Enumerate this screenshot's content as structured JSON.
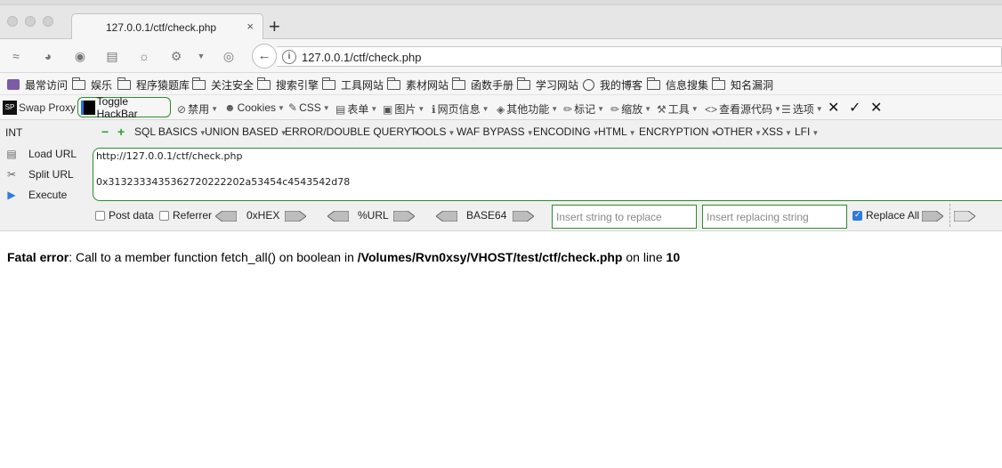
{
  "tab": {
    "title": "127.0.0.1/ctf/check.php",
    "close": "×",
    "new_tab": "+"
  },
  "nav": {
    "url": "127.0.0.1/ctf/check.php",
    "info_glyph": "i"
  },
  "bookmarks": [
    {
      "label": "最常访问",
      "icon": "purple-square-icon"
    },
    {
      "label": "娱乐",
      "icon": "folder-icon"
    },
    {
      "label": "程序猿题库",
      "icon": "folder-icon"
    },
    {
      "label": "关注安全",
      "icon": "folder-icon"
    },
    {
      "label": "搜索引擎",
      "icon": "folder-icon"
    },
    {
      "label": "工具网站",
      "icon": "folder-icon"
    },
    {
      "label": "素材网站",
      "icon": "folder-icon"
    },
    {
      "label": "函数手册",
      "icon": "folder-icon"
    },
    {
      "label": "学习网站",
      "icon": "folder-icon"
    },
    {
      "label": "我的博客",
      "icon": "globe-icon"
    },
    {
      "label": "信息搜集",
      "icon": "folder-icon"
    },
    {
      "label": "知名漏洞",
      "icon": "folder-icon"
    }
  ],
  "extensions": {
    "swap_proxy": "Swap Proxy",
    "sp_glyph": "SP",
    "toggle_hackbar": "Toggle HackBar",
    "items": [
      "禁用",
      "Cookies",
      "CSS",
      "表单",
      "图片",
      "网页信息",
      "其他功能",
      "标记",
      "缩放",
      "工具",
      "查看源代码",
      "选项"
    ],
    "actions": [
      "✕",
      "✓",
      "✕"
    ]
  },
  "hackbar": {
    "type_label": "INT",
    "menus": [
      "SQL BASICS",
      "UNION BASED",
      "ERROR/DOUBLE QUERY",
      "TOOLS",
      "WAF BYPASS",
      "ENCODING",
      "HTML",
      "ENCRYPTION",
      "OTHER",
      "XSS",
      "LFI"
    ],
    "load_url": "Load URL",
    "split_url": "Split URL",
    "execute": "Execute",
    "url_line1": "http://127.0.0.1/ctf/check.php",
    "url_line2": "0x3132333435362720222202a53454c4543542d78",
    "post_data": "Post data",
    "referrer": "Referrer",
    "hex_label": "0xHEX",
    "url_label": "%URL",
    "base64_label": "BASE64",
    "replace_placeholder": "Insert string to replace",
    "replacing_placeholder": "Insert replacing string",
    "replace_all": "Replace All",
    "replace_all_checked": true
  },
  "page": {
    "error_label": "Fatal error",
    "error_message": ": Call to a member function fetch_all() on boolean in ",
    "error_path": "/Volumes/Rvn0xsy/VHOST/test/ctf/check.php",
    "error_line_text": " on line ",
    "error_line": "10"
  },
  "colors": {
    "hackbar_border": "#2e8b2e",
    "checkbox_on": "#2f7bdc"
  }
}
